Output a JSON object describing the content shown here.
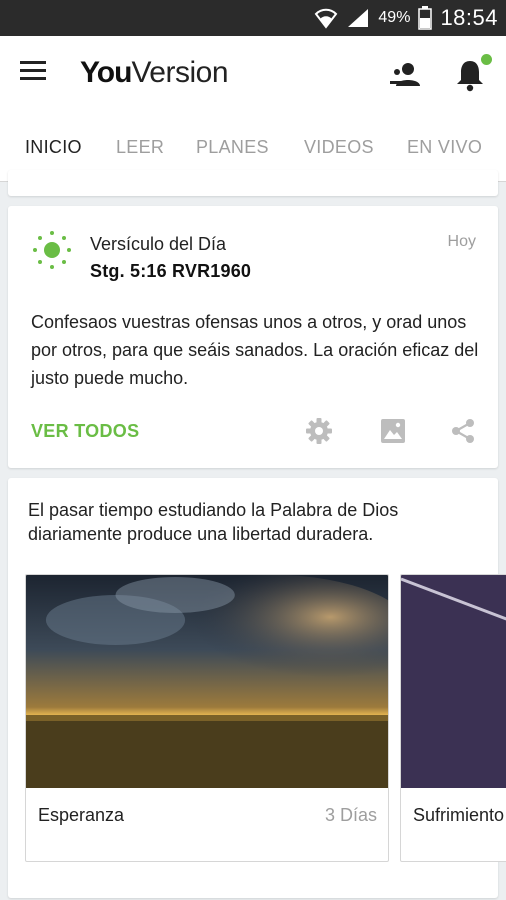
{
  "status_bar": {
    "battery_pct": "49%",
    "time": "18:54",
    "icons": [
      "wifi-icon",
      "signal-icon",
      "battery-icon"
    ]
  },
  "app_bar": {
    "logo_you": "You",
    "logo_version": "Version",
    "icons": [
      "menu-icon",
      "friends-icon",
      "notifications-icon"
    ],
    "notification_dot_color": "#6abd45"
  },
  "tabs": [
    {
      "label": "INICIO",
      "active": true
    },
    {
      "label": "LEER",
      "active": false
    },
    {
      "label": "PLANES",
      "active": false
    },
    {
      "label": "VIDEOS",
      "active": false
    },
    {
      "label": "EN VIVO",
      "active": false
    }
  ],
  "verse_of_day": {
    "title": "Versículo del Día",
    "reference": "Stg. 5:16 RVR1960",
    "date": "Hoy",
    "text": "Confesaos vuestras ofensas unos a otros, y orad unos por otros, para que seáis sanados. La oración eficaz del justo puede mucho.",
    "view_all": "VER TODOS",
    "icons": [
      "sun-icon",
      "gear-icon",
      "image-icon",
      "share-icon"
    ]
  },
  "plans": {
    "description": "El pasar tiempo estudiando la Palabra de Dios diariamente produce una libertad duradera.",
    "items": [
      {
        "name": "Esperanza",
        "days": "3 Días"
      },
      {
        "name": "Sufrimiento",
        "days": ""
      }
    ]
  },
  "colors": {
    "accent": "#6abd45",
    "text": "#222222",
    "muted": "#9e9e9e",
    "background": "#eceff1"
  }
}
